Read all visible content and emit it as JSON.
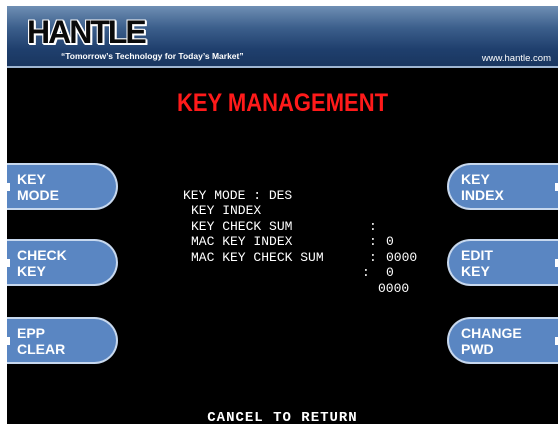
{
  "header": {
    "logo_text": "HANTLE",
    "tagline": "“Tomorrow’s Technology for Today’s Market”",
    "website": "www.hantle.com"
  },
  "title": "KEY MANAGEMENT",
  "left_keys": [
    {
      "line1": "KEY",
      "line2": "MODE"
    },
    {
      "line1": "CHECK",
      "line2": "KEY"
    },
    {
      "line1": "EPP",
      "line2": "CLEAR"
    }
  ],
  "right_keys": [
    {
      "line1": "KEY",
      "line2": "INDEX"
    },
    {
      "line1": "EDIT",
      "line2": "KEY"
    },
    {
      "line1": "CHANGE",
      "line2": "PWD"
    }
  ],
  "info": {
    "key_mode": "KEY MODE : DES",
    "rows": [
      {
        "label": "KEY INDEX",
        "sep": ":",
        "value": "0"
      },
      {
        "label": "KEY CHECK SUM",
        "sep": ":",
        "value": "0000"
      },
      {
        "label": "MAC KEY INDEX",
        "sep": ":",
        "value": "0"
      },
      {
        "label": "MAC KEY CHECK SUM",
        "sep": ":",
        "value": "0000"
      }
    ]
  },
  "footer": "CANCEL TO RETURN"
}
